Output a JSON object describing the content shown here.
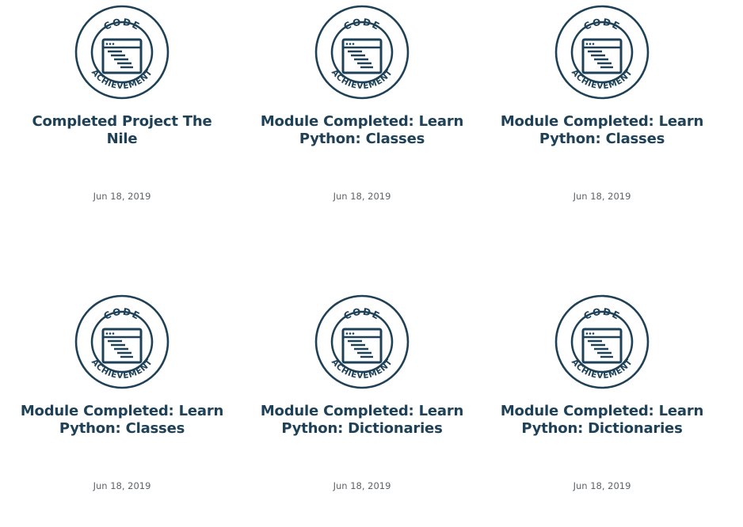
{
  "accent_color": "#1e4157",
  "badge": {
    "top_text": "CODE",
    "bottom_text": "ACHIEVEMENT",
    "icon": "code-window-icon"
  },
  "achievements": [
    {
      "title": "Completed Project The Nile",
      "date": "Jun 18, 2019"
    },
    {
      "title": "Module Completed: Learn Python: Classes",
      "date": "Jun 18, 2019"
    },
    {
      "title": "Module Completed: Learn Python: Classes",
      "date": "Jun 18, 2019"
    },
    {
      "title": "Module Completed: Learn Python: Classes",
      "date": "Jun 18, 2019"
    },
    {
      "title": "Module Completed: Learn Python: Dictionaries",
      "date": "Jun 18, 2019"
    },
    {
      "title": "Module Completed: Learn Python: Dictionaries",
      "date": "Jun 18, 2019"
    }
  ]
}
